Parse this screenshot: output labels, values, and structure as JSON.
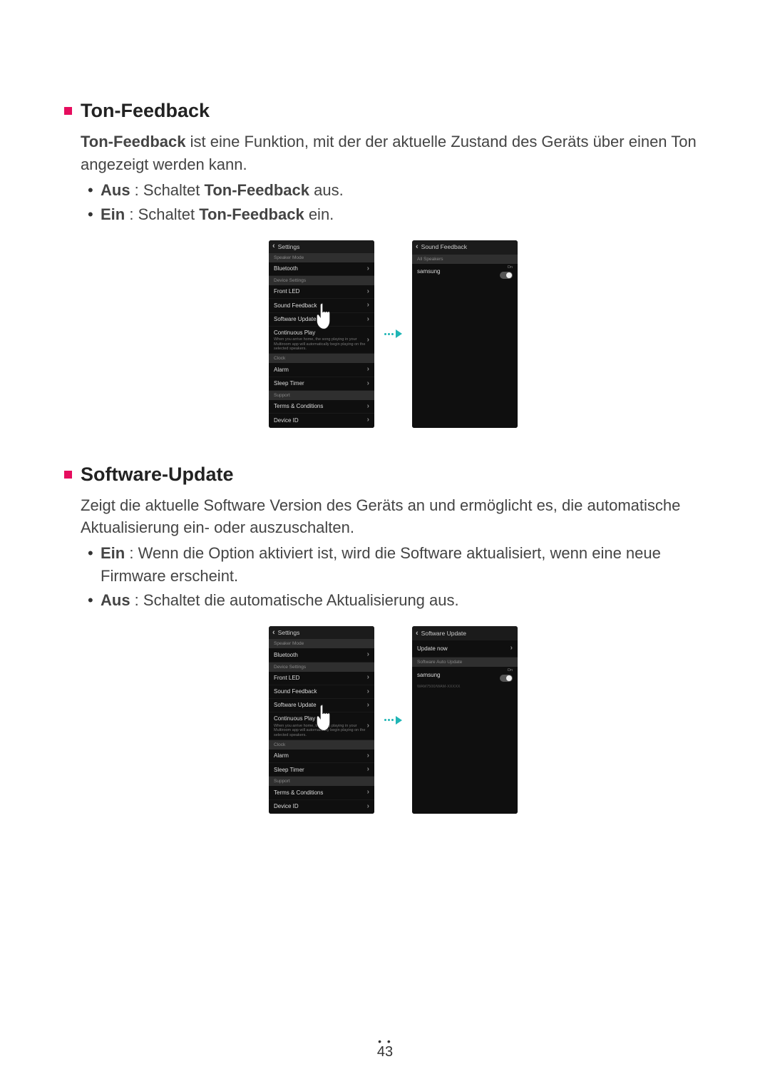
{
  "section1": {
    "title": "Ton-Feedback",
    "intro_prefix": "Ton-Feedback",
    "intro_rest": " ist eine Funktion, mit der der aktuelle Zustand des Geräts über einen Ton angezeigt werden kann.",
    "bullets": [
      {
        "label": "Aus",
        "mid": " : Schaltet ",
        "bold2": "Ton-Feedback",
        "end": " aus."
      },
      {
        "label": "Ein",
        "mid": " : Schaltet ",
        "bold2": "Ton-Feedback",
        "end": " ein."
      }
    ]
  },
  "section2": {
    "title": "Software-Update",
    "intro": "Zeigt die aktuelle Software Version des Geräts an und ermöglicht es, die automatische Aktualisierung ein- oder auszuschalten.",
    "bullets": [
      {
        "label": "Ein",
        "rest": " : Wenn die Option aktiviert ist, wird die Software aktualisiert, wenn eine neue Firmware erscheint."
      },
      {
        "label": "Aus",
        "rest": " : Schaltet die automatische Aktualisierung aus."
      }
    ]
  },
  "settings_screen": {
    "title": "Settings",
    "sections": {
      "speaker_mode": "Speaker Mode",
      "device_settings": "Device Settings",
      "clock": "Clock",
      "support": "Support"
    },
    "rows": {
      "bluetooth": "Bluetooth",
      "front_led": "Front LED",
      "sound_feedback": "Sound Feedback",
      "software_update": "Software Update",
      "continuous_play": "Continuous Play",
      "continuous_play_sub": "When you arrive home, the song playing in your Multiroom app will automatically begin playing on the selected speakers.",
      "alarm": "Alarm",
      "sleep_timer": "Sleep Timer",
      "terms": "Terms & Conditions",
      "device_id": "Device ID"
    }
  },
  "sound_feedback_screen": {
    "title": "Sound Feedback",
    "section": "All Speakers",
    "speaker": "samsung",
    "toggle": "On"
  },
  "software_update_screen": {
    "title": "Software Update",
    "update_now": "Update now",
    "section": "Software Auto Update",
    "speaker": "samsung",
    "model": "WAM7500/WAM-XXXXX",
    "toggle": "On"
  },
  "page_number": "43"
}
